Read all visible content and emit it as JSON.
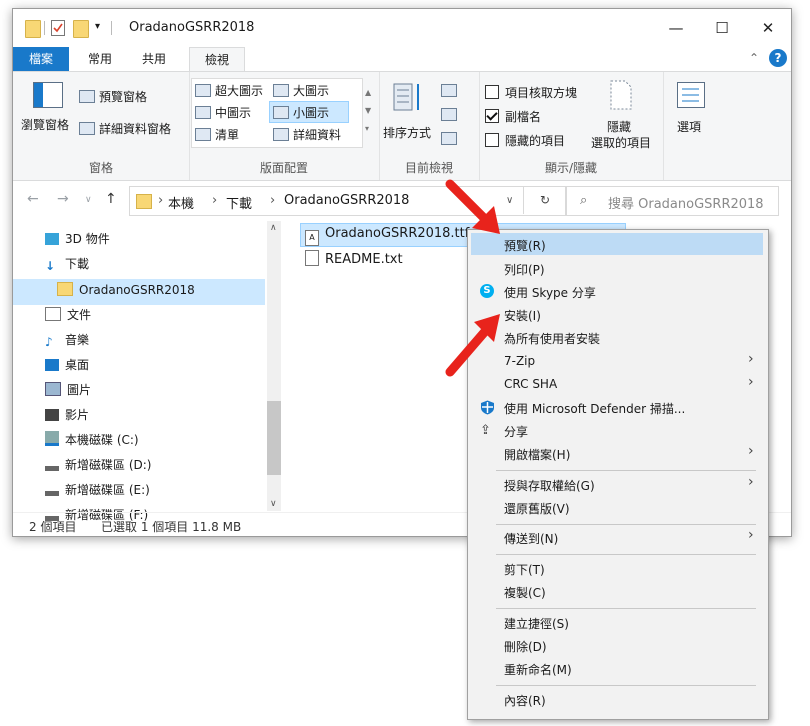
{
  "window": {
    "title": "OradanoGSRR2018",
    "controls": [
      "—",
      "☐",
      "✕"
    ]
  },
  "ribbon_tabs": {
    "file": "檔案",
    "home": "常用",
    "share": "共用",
    "view": "檢視"
  },
  "ribbon": {
    "panes": {
      "navigation_pane": "瀏覽窗格",
      "preview_pane": "預覽窗格",
      "details_pane": "詳細資料窗格",
      "label": "窗格"
    },
    "layout": {
      "extra_large": "超大圖示",
      "large": "大圖示",
      "medium": "中圖示",
      "small": "小圖示",
      "list": "清單",
      "details": "詳細資料",
      "label": "版面配置"
    },
    "current_view": {
      "sort": "排序方式",
      "label": "目前檢視"
    },
    "show_hide": {
      "item_checkboxes": "項目核取方塊",
      "extensions": "副檔名",
      "hidden_items": "隱藏的項目",
      "hide_selected_line1": "隱藏",
      "hide_selected_line2": "選取的項目",
      "label": "顯示/隱藏",
      "item_checkboxes_checked": false,
      "extensions_checked": true,
      "hidden_items_checked": false
    },
    "options": "選項"
  },
  "address": {
    "crumbs": [
      "本機",
      "下載",
      "OradanoGSRR2018"
    ],
    "search_placeholder": "搜尋 OradanoGSRR2018"
  },
  "nav_items": [
    "3D 物件",
    "下載",
    "OradanoGSRR2018",
    "文件",
    "音樂",
    "桌面",
    "圖片",
    "影片",
    "本機磁碟 (C:)",
    "新增磁碟區 (D:)",
    "新增磁碟區 (E:)",
    "新增磁碟區 (F:)"
  ],
  "files": [
    "OradanoGSRR2018.ttf",
    "README.txt"
  ],
  "status": {
    "count": "2 個項目",
    "selected": "已選取 1 個項目 11.8 MB"
  },
  "context_menu": [
    "預覽(R)",
    "列印(P)",
    "使用 Skype 分享",
    "安裝(I)",
    "為所有使用者安裝",
    "7-Zip",
    "CRC SHA",
    "使用 Microsoft Defender 掃描...",
    "分享",
    "開啟檔案(H)",
    "授與存取權給(G)",
    "還原舊版(V)",
    "傳送到(N)",
    "剪下(T)",
    "複製(C)",
    "建立捷徑(S)",
    "刪除(D)",
    "重新命名(M)",
    "內容(R)"
  ],
  "colors": {
    "accent": "#1979ca",
    "selection": "#cce8ff",
    "arrow": "#e8231c"
  }
}
